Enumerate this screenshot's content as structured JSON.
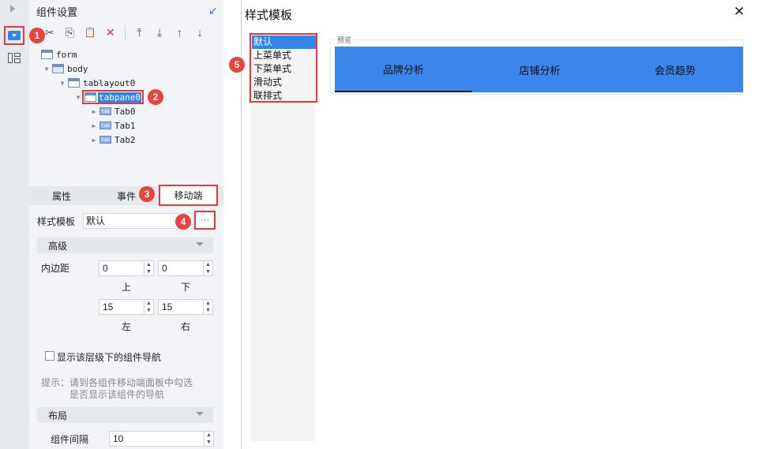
{
  "panel": {
    "title": "组件设置",
    "toolbar": [
      {
        "name": "cut-icon",
        "glyph": "✂"
      },
      {
        "name": "copy-icon",
        "glyph": "⎘"
      },
      {
        "name": "paste-icon",
        "glyph": "📋"
      },
      {
        "name": "delete-icon",
        "glyph": "✕"
      },
      {
        "name": "move-top-icon",
        "glyph": "⤒"
      },
      {
        "name": "move-bottom-icon",
        "glyph": "⤓"
      },
      {
        "name": "move-up-icon",
        "glyph": "↑"
      },
      {
        "name": "move-down-icon",
        "glyph": "↓"
      }
    ],
    "tree": {
      "form": "form",
      "body": "body",
      "tablayout": "tablayout0",
      "tabpane": "tabpane0",
      "tab0": "Tab0",
      "tab1": "Tab1",
      "tab2": "Tab2"
    },
    "tabs": {
      "properties": "属性",
      "events": "事件",
      "mobile": "移动端"
    },
    "style_template_label": "样式模板",
    "style_template_value": "默认",
    "more_button": "···",
    "advanced_label": "高级",
    "padding_label": "内边距",
    "padding": {
      "top": "0",
      "bottom": "0",
      "left": "15",
      "right": "15",
      "top_label": "上",
      "bottom_label": "下",
      "left_label": "左",
      "right_label": "右"
    },
    "show_nav_label": "显示该层级下的组件导航",
    "hint_line1": "提示：请到各组件移动端面板中勾选",
    "hint_line2": "是否显示该组件的导航",
    "layout_label": "布局",
    "spacing_label": "组件间隔",
    "spacing_value": "10"
  },
  "badges": [
    "1",
    "2",
    "3",
    "4",
    "5"
  ],
  "dialog": {
    "title": "样式模板",
    "close": "✕",
    "templates": [
      "默认",
      "上菜单式",
      "下菜单式",
      "滑动式",
      "联排式"
    ],
    "selected_template": "默认",
    "preview_label": "预览",
    "preview_tabs": [
      "品牌分析",
      "店铺分析",
      "会员趋势"
    ]
  },
  "colors": {
    "accent": "#3285e6",
    "preview_bar": "#3a86eb",
    "highlight_red": "#e03a3a",
    "badge_red": "#e8433f"
  }
}
